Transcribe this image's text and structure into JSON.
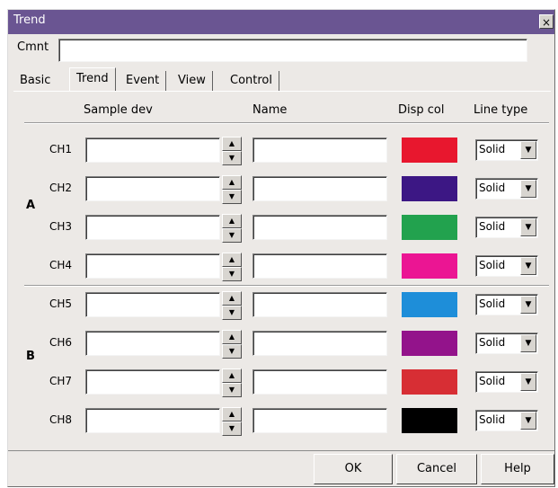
{
  "window": {
    "title": "Trend",
    "close_glyph": "×"
  },
  "comment": {
    "label": "Cmnt",
    "value": ""
  },
  "tabs": [
    "Basic",
    "Trend",
    "Event",
    "View",
    "Control"
  ],
  "active_tab": "Trend",
  "headers": {
    "sample_dev": "Sample dev",
    "name": "Name",
    "disp_col": "Disp col",
    "line_type": "Line type"
  },
  "groups": [
    "A",
    "B"
  ],
  "channels": [
    {
      "label": "CH1",
      "sample_dev": "",
      "name": "",
      "color": "#e8172e",
      "line_type": "Solid"
    },
    {
      "label": "CH2",
      "sample_dev": "",
      "name": "",
      "color": "#3c1784",
      "line_type": "Solid"
    },
    {
      "label": "CH3",
      "sample_dev": "",
      "name": "",
      "color": "#22a24e",
      "line_type": "Solid"
    },
    {
      "label": "CH4",
      "sample_dev": "",
      "name": "",
      "color": "#eb1593",
      "line_type": "Solid"
    },
    {
      "label": "CH5",
      "sample_dev": "",
      "name": "",
      "color": "#1e8ed9",
      "line_type": "Solid"
    },
    {
      "label": "CH6",
      "sample_dev": "",
      "name": "",
      "color": "#93138b",
      "line_type": "Solid"
    },
    {
      "label": "CH7",
      "sample_dev": "",
      "name": "",
      "color": "#d72e34",
      "line_type": "Solid"
    },
    {
      "label": "CH8",
      "sample_dev": "",
      "name": "",
      "color": "#000000",
      "line_type": "Solid"
    }
  ],
  "icons": {
    "spin_up": "up-arrow-icon",
    "spin_down": "down-arrow-icon",
    "dropdown": "chevron-down-icon"
  },
  "buttons": {
    "ok": "OK",
    "cancel": "Cancel",
    "help": "Help"
  }
}
